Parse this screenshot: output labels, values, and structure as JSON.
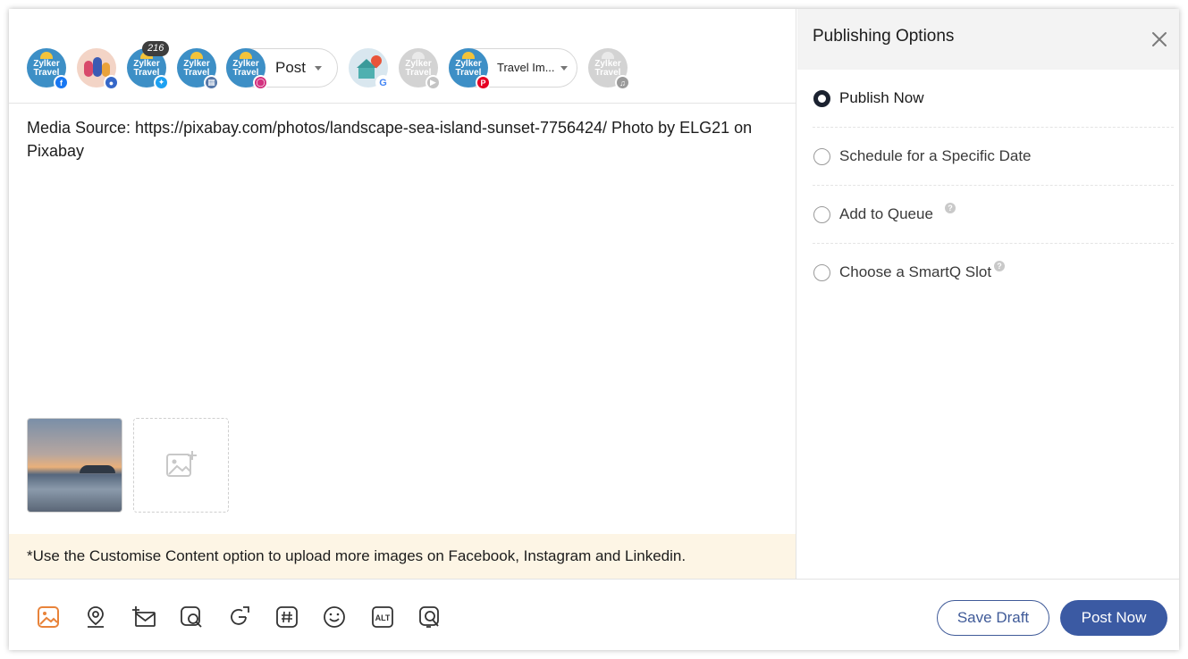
{
  "channels": {
    "avatar_text_line1": "Zylker",
    "avatar_text_line2": "Travel",
    "twitter_count": "216",
    "instagram_type": "Post",
    "pinterest_board": "Travel Im...",
    "google_badge": "G"
  },
  "composer": {
    "text": "Media Source: https://pixabay.com/photos/landscape-sea-island-sunset-7756424/ Photo by ELG21 on Pixabay",
    "notice": "*Use the Customise Content option to upload more images on Facebook, Instagram and Linkedin."
  },
  "panel": {
    "title": "Publishing Options",
    "options": [
      {
        "label": "Publish Now",
        "selected": true
      },
      {
        "label": "Schedule for a Specific Date",
        "selected": false
      },
      {
        "label": "Add to Queue",
        "selected": false
      },
      {
        "label": "Choose a SmartQ Slot",
        "selected": false
      }
    ],
    "help_glyph": "?"
  },
  "footer": {
    "save_draft": "Save Draft",
    "post_now": "Post Now",
    "alt_label": "ALT"
  },
  "colors": {
    "primary": "#3b5aa3",
    "notice_bg": "#fdf5e5",
    "media_icon_accent": "#e8833a"
  }
}
